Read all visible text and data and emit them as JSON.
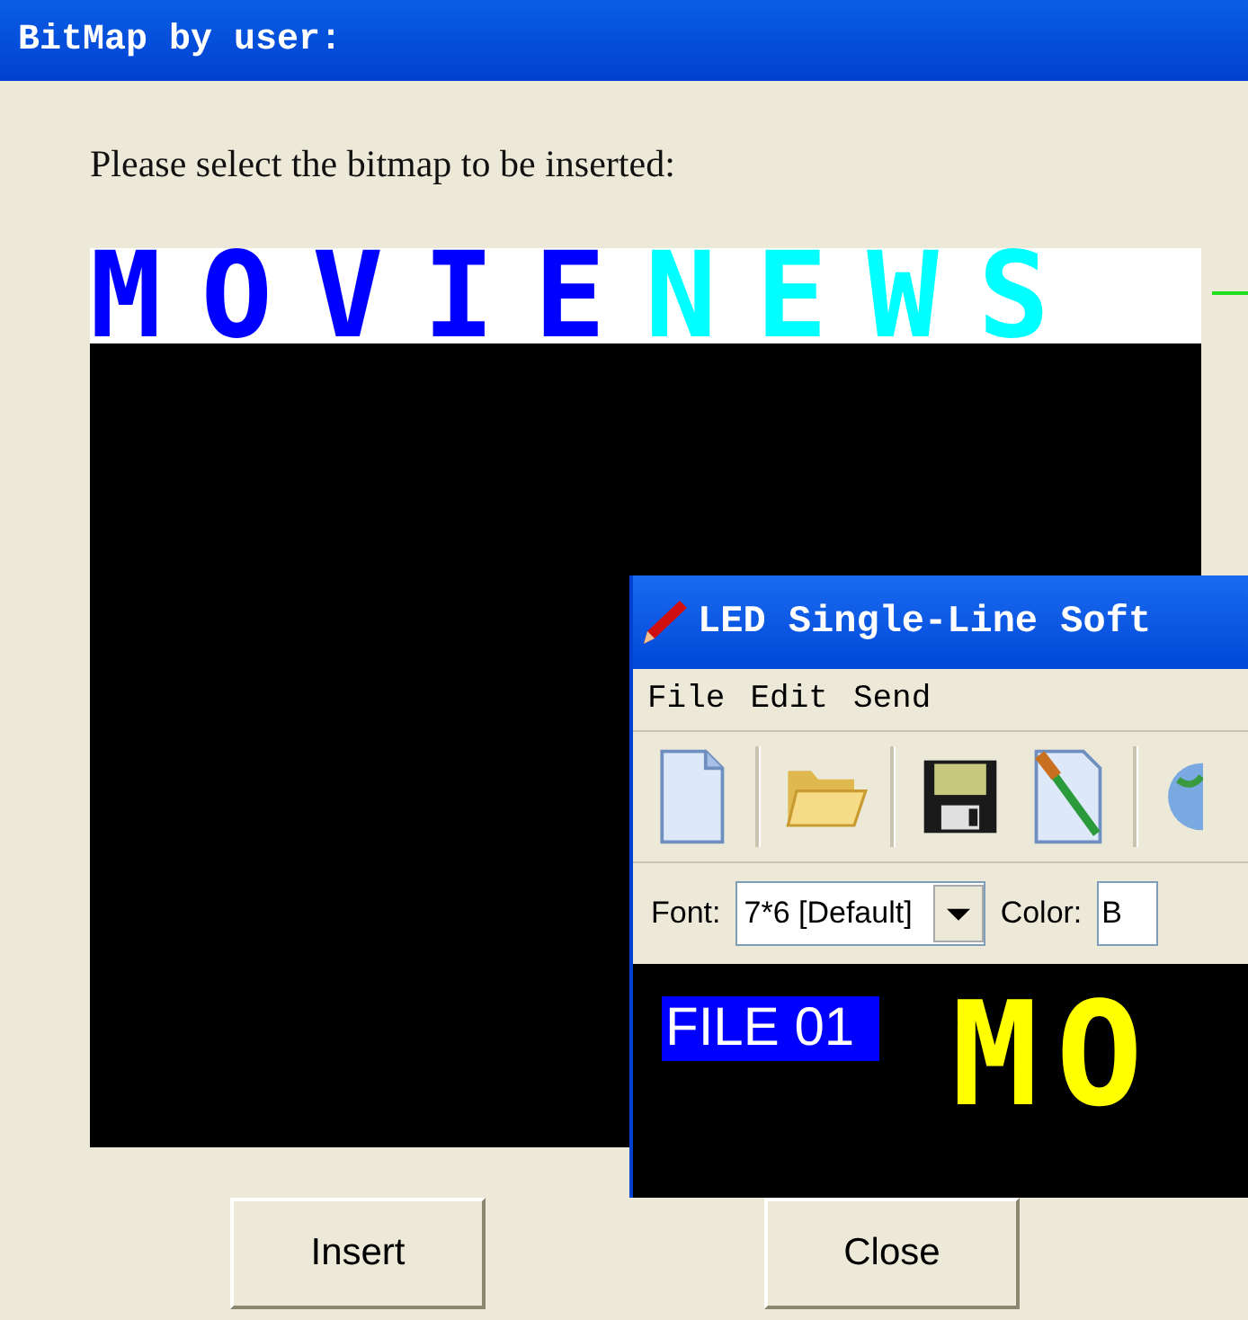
{
  "dialog": {
    "title": "BitMap by user:",
    "prompt": "Please select the bitmap to be inserted:",
    "preview": {
      "segments": [
        {
          "text": "MOVIE",
          "color": "#0000ff"
        },
        {
          "text": "NEWS",
          "color": "#00ffff"
        }
      ]
    },
    "buttons": [
      "Insert",
      "Close"
    ]
  },
  "led_window": {
    "title": "LED Single-Line Soft",
    "menu": [
      "File",
      "Edit",
      "Send"
    ],
    "font_label": "Font:",
    "font_value": "7*6 [Default]",
    "color_label": "Color:",
    "color_value": "B",
    "display": {
      "file_label": "FILE 01",
      "text": "MO"
    }
  }
}
